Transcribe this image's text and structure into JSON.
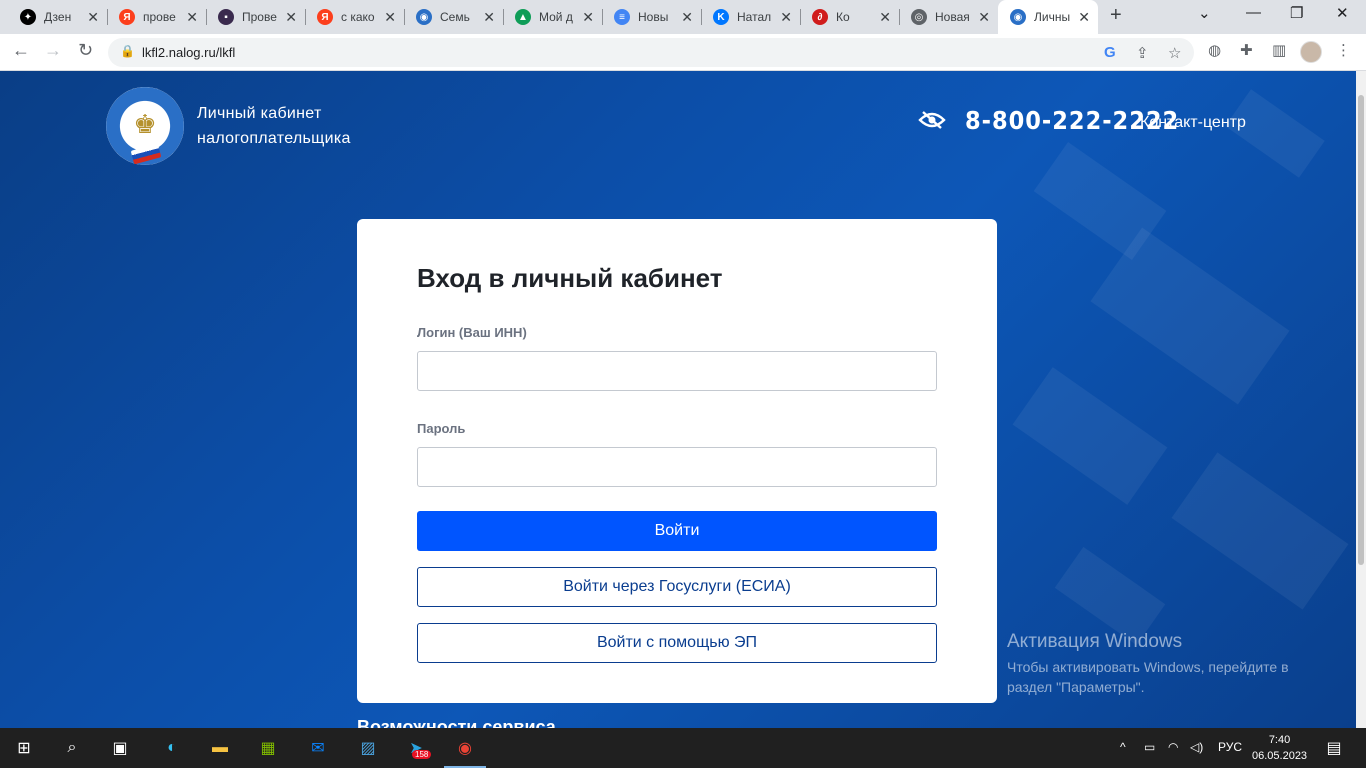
{
  "browser": {
    "tabs": [
      {
        "title": "Дзен",
        "icon": "dzen-icon",
        "color": "#000000",
        "glyph": "✦"
      },
      {
        "title": "прове",
        "icon": "yandex-icon",
        "color": "#fc3f1d",
        "glyph": "Я"
      },
      {
        "title": "Прове",
        "icon": "site-icon",
        "color": "#3a2a4e",
        "glyph": "▪"
      },
      {
        "title": "с како",
        "icon": "yandex-icon",
        "color": "#fc3f1d",
        "glyph": "Я"
      },
      {
        "title": "Семь",
        "icon": "fns-icon",
        "color": "#2a6fc6",
        "glyph": "◉"
      },
      {
        "title": "Мой д",
        "icon": "google-drive-icon",
        "color": "#0f9d58",
        "glyph": "▲"
      },
      {
        "title": "Новы",
        "icon": "google-docs-icon",
        "color": "#4285f4",
        "glyph": "≡"
      },
      {
        "title": "Натал",
        "icon": "vk-icon",
        "color": "#0077ff",
        "glyph": "K"
      },
      {
        "title": "Ко",
        "icon": "avito-icon",
        "color": "#d01c1c",
        "glyph": "∂"
      },
      {
        "title": "Новая",
        "icon": "chrome-icon",
        "color": "#5f6368",
        "glyph": "◎"
      },
      {
        "title": "Личны",
        "icon": "fns-icon",
        "color": "#2a6fc6",
        "glyph": "◉"
      }
    ],
    "url": "lkfl2.nalog.ru/lkfl"
  },
  "header": {
    "site_name_line1": "Личный кабинет",
    "site_name_line2": "налогоплательщика",
    "phone": "8-800-222-2222",
    "contact_label": "Контакт-центр"
  },
  "login": {
    "title": "Вход в личный кабинет",
    "login_label": "Логин (Ваш ИНН)",
    "login_value": "",
    "password_label": "Пароль",
    "password_value": "",
    "submit_label": "Войти",
    "gosuslugi_label": "Войти через Госуслуги (ЕСИА)",
    "ep_label": "Войти с помощью ЭП"
  },
  "below_text": "Возможности сервиса",
  "watermark": {
    "title": "Активация Windows",
    "text": "Чтобы активировать Windows, перейдите в раздел \"Параметры\"."
  },
  "taskbar": {
    "telegram_badge": "158",
    "language": "РУС",
    "time": "7:40",
    "date": "06.05.2023"
  },
  "colors": {
    "page_bg": "#0c4ea8",
    "primary_button": "#0055ff",
    "outline_button": "#0a3d8f"
  }
}
